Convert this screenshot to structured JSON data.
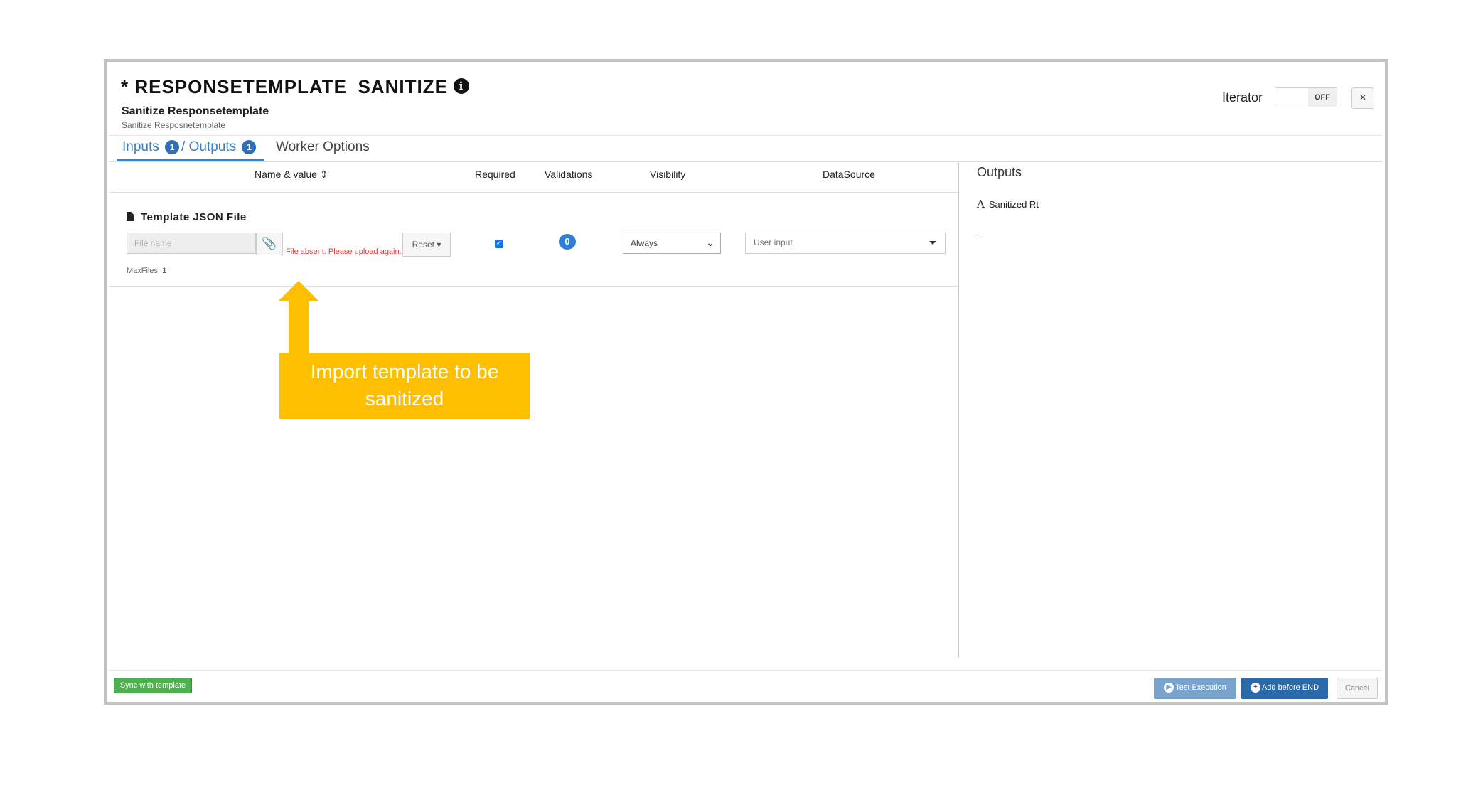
{
  "dialog": {
    "title": "* RESPONSETEMPLATE_SANITIZE",
    "subtitle": "Sanitize Responsetemplate",
    "description": "Sanitize Resposnetemplate",
    "iterator_label": "Iterator",
    "iterator_state": "OFF",
    "close_label": "×"
  },
  "tabs": {
    "inputs_label": "Inputs",
    "inputs_count": "1",
    "outputs_label": "/ Outputs",
    "outputs_count": "1",
    "worker_options_label": "Worker Options"
  },
  "columns": {
    "name_value": "Name & value",
    "required": "Required",
    "validations": "Validations",
    "visibility": "Visibility",
    "data_source": "DataSource"
  },
  "input_row": {
    "title": "Template JSON File",
    "file_placeholder": "File name",
    "error": "File absent. Please upload again.",
    "reset_label": "Reset",
    "max_files_label": "MaxFiles:",
    "max_files_value": "1",
    "required_checked": true,
    "validations_count": "0",
    "visibility_value": "Always",
    "data_source_value": "User input"
  },
  "outputs_panel": {
    "title": "Outputs",
    "item_label": "Sanitized Rt",
    "item_value": "-"
  },
  "callout": {
    "text": "Import template to be sanitized",
    "color": "#fdbf00"
  },
  "footer": {
    "sync_label": "Sync with template",
    "test_label": "Test Execution",
    "add_label": "Add before END",
    "cancel_label": "Cancel"
  }
}
